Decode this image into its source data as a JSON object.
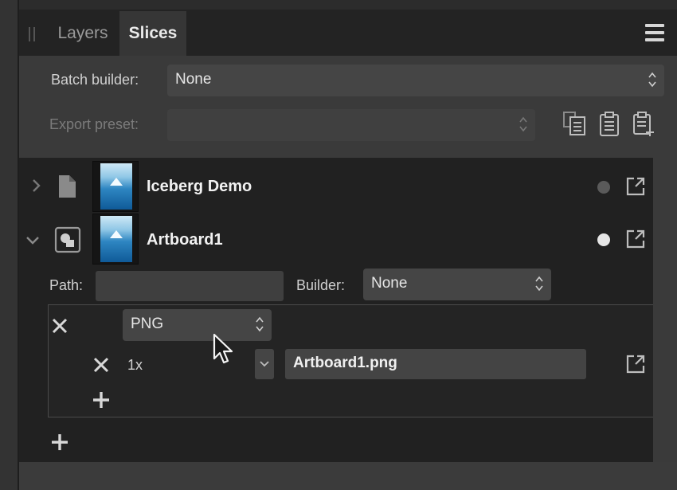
{
  "tabs": [
    {
      "label": "Layers",
      "active": false
    },
    {
      "label": "Slices",
      "active": true
    }
  ],
  "batch_builder": {
    "label": "Batch builder:",
    "value": "None"
  },
  "export_preset": {
    "label": "Export preset:",
    "value": ""
  },
  "rows": [
    {
      "title": "Iceberg Demo",
      "expanded": false,
      "status_color": "#5a5a5a"
    },
    {
      "title": "Artboard1",
      "expanded": true,
      "status_color": "#e6e6e6"
    }
  ],
  "artboard": {
    "path_label": "Path:",
    "path_value": "",
    "builder_label": "Builder:",
    "builder_value": "None",
    "format": "PNG",
    "scale": "1x",
    "filename": "Artboard1.png"
  },
  "icons": {
    "menu": "hamburger-menu-icon",
    "expand": "chevron-right-icon",
    "collapse": "chevron-down-icon",
    "export": "export-arrow-icon",
    "remove": "close-icon",
    "add": "plus-icon"
  },
  "colors": {
    "panel_bg": "#3a3a3a",
    "list_bg": "#212121",
    "tab_bar_bg": "#232323"
  }
}
